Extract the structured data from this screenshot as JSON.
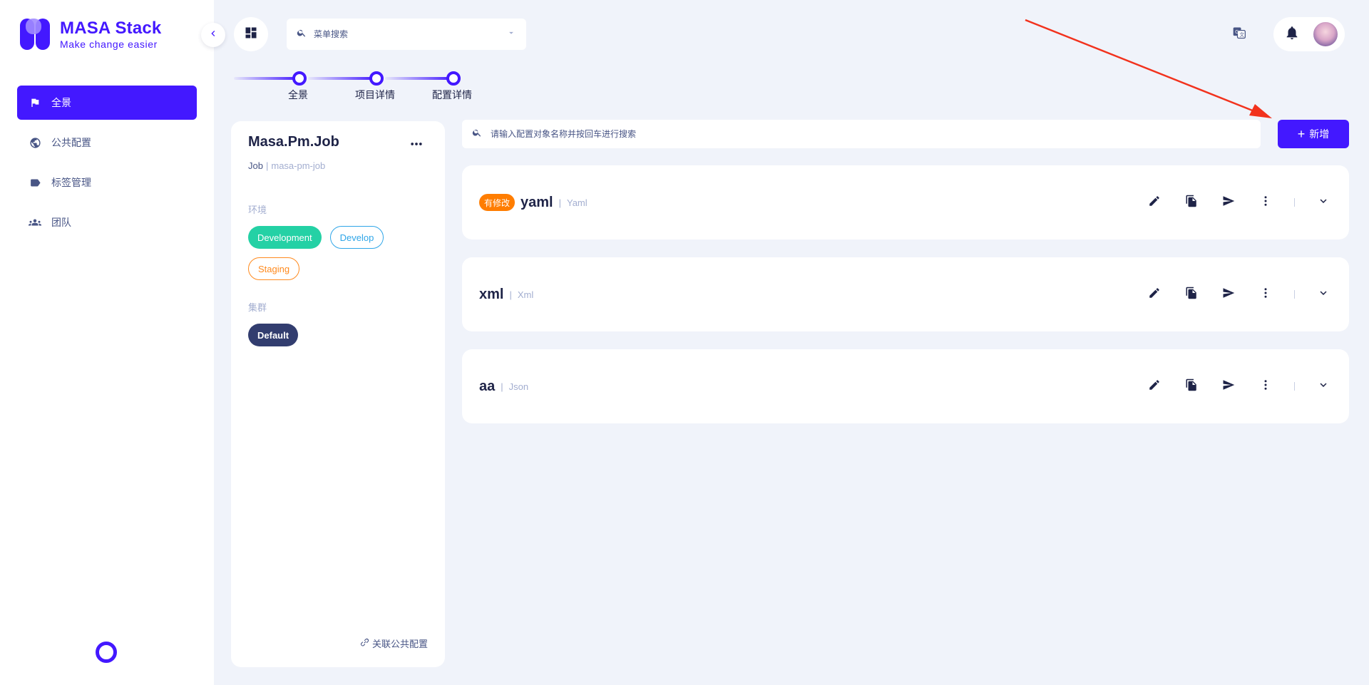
{
  "app": {
    "logo_title": "MASA Stack",
    "logo_subtitle": "Make change easier"
  },
  "sidebar": {
    "items": [
      {
        "label": "全景",
        "icon": "flag-icon",
        "active": true
      },
      {
        "label": "公共配置",
        "icon": "globe-icon",
        "active": false
      },
      {
        "label": "标签管理",
        "icon": "label-icon",
        "active": false
      },
      {
        "label": "团队",
        "icon": "team-icon",
        "active": false
      }
    ]
  },
  "header": {
    "menu_search_placeholder": "菜单搜索"
  },
  "stepper": {
    "steps": [
      "全景",
      "项目详情",
      "配置详情"
    ]
  },
  "project": {
    "name": "Masa.Pm.Job",
    "type": "Job",
    "identity": "masa-pm-job",
    "env_label": "环境",
    "environments": [
      "Development",
      "Develop",
      "Staging"
    ],
    "cluster_label": "集群",
    "clusters": [
      "Default"
    ],
    "link_public_config": "关联公共配置"
  },
  "config": {
    "search_placeholder": "请输入配置对象名称并按回车进行搜索",
    "add_label": "新增",
    "items": [
      {
        "name": "yaml",
        "format": "Yaml",
        "badge": "有修改"
      },
      {
        "name": "xml",
        "format": "Xml",
        "badge": ""
      },
      {
        "name": "aa",
        "format": "Json",
        "badge": ""
      }
    ]
  },
  "colors": {
    "primary": "#4318ff",
    "text": "#1e2347",
    "muted": "#a3aed0",
    "background": "#f0f3fa",
    "env_development": "#24d1a5",
    "env_develop": "#2fa6e8",
    "env_staging": "#ff8a1e",
    "cluster_default": "#323d6f",
    "badge_modified": "#ff7d00",
    "annotation_arrow": "#f2321d"
  }
}
